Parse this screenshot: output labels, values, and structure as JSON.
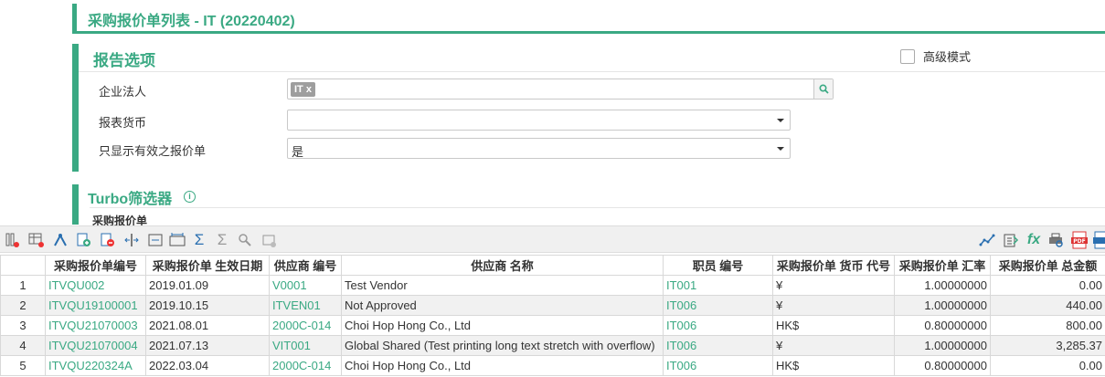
{
  "page": {
    "title": "采购报价单列表 - IT (20220402)"
  },
  "report_options": {
    "title": "报告选项",
    "advanced_mode_label": "高级模式",
    "fields": [
      {
        "label": "企业法人",
        "tag": "IT",
        "tag_remove": "x"
      },
      {
        "label": "报表货币",
        "value": ""
      },
      {
        "label": "只显示有效之报价单",
        "value": "是"
      }
    ]
  },
  "turbo": {
    "title": "Turbo筛选器",
    "subtitle": "采购报价单"
  },
  "toolbar": {
    "icons_left": [
      "column-settings-icon",
      "table-settings-icon",
      "run-icon",
      "add-row-icon",
      "remove-row-icon",
      "expand-columns-icon",
      "fit-columns-icon",
      "auto-width-icon",
      "sum-icon",
      "sum-off-icon",
      "show-hidden-icon",
      "group-icon"
    ],
    "icons_right": [
      "chart-icon",
      "export-icon",
      "formula-icon",
      "print-preview-icon",
      "pdf-icon",
      "xls-icon"
    ]
  },
  "table": {
    "columns": [
      "",
      "采购报价单编号",
      "采购报价单 生效日期",
      "供应商 编号",
      "供应商 名称",
      "职员 编号",
      "采购报价单 货币 代号",
      "采购报价单 汇率",
      "采购报价单 总金额"
    ],
    "rows": [
      [
        "1",
        "ITVQU002",
        "2019.01.09",
        "V0001",
        "Test Vendor",
        "IT001",
        "¥",
        "1.00000000",
        "0.00"
      ],
      [
        "2",
        "ITVQU19100001",
        "2019.10.15",
        "ITVEN01",
        "Not Approved",
        "IT006",
        "¥",
        "1.00000000",
        "440.00"
      ],
      [
        "3",
        "ITVQU21070003",
        "2021.08.01",
        "2000C-014",
        "Choi Hop Hong Co., Ltd",
        "IT006",
        "HK$",
        "0.80000000",
        "800.00"
      ],
      [
        "4",
        "ITVQU21070004",
        "2021.07.13",
        "VIT001",
        "Global Shared (Test printing long text stretch with overflow)",
        "IT006",
        "¥",
        "1.00000000",
        "3,285.37"
      ],
      [
        "5",
        "ITVQU220324A",
        "2022.03.04",
        "2000C-014",
        "Choi Hop Hong Co., Ltd",
        "IT006",
        "HK$",
        "0.80000000",
        "0.00"
      ]
    ]
  },
  "colors": {
    "accent": "#3aa983",
    "row_alt": "#f1f1f1"
  }
}
